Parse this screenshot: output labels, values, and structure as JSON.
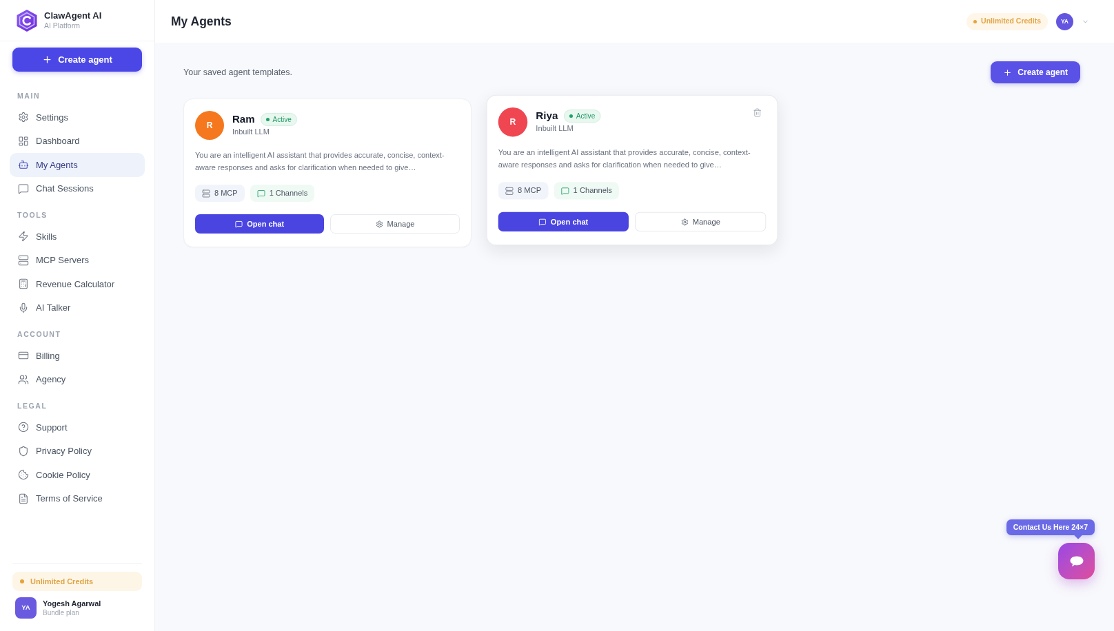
{
  "sidebar": {
    "brand": {
      "name": "ClawAgent AI",
      "tagline": "AI Platform"
    },
    "create_button": "Create agent",
    "sections": [
      {
        "title": "MAIN",
        "items": [
          {
            "label": "Settings",
            "selected": false
          },
          {
            "label": "Dashboard",
            "selected": false
          },
          {
            "label": "My Agents",
            "selected": true
          },
          {
            "label": "Chat Sessions",
            "selected": false
          }
        ]
      },
      {
        "title": "TOOLS",
        "items": [
          {
            "label": "Skills",
            "selected": false
          },
          {
            "label": "MCP Servers",
            "selected": false
          },
          {
            "label": "Revenue Calculator",
            "selected": false
          },
          {
            "label": "AI Talker",
            "selected": false
          }
        ]
      },
      {
        "title": "ACCOUNT",
        "items": [
          {
            "label": "Billing",
            "selected": false
          },
          {
            "label": "Agency",
            "selected": false
          }
        ]
      },
      {
        "title": "LEGAL",
        "items": [
          {
            "label": "Support",
            "selected": false
          },
          {
            "label": "Privacy Policy",
            "selected": false
          },
          {
            "label": "Cookie Policy",
            "selected": false
          },
          {
            "label": "Terms of Service",
            "selected": false
          }
        ]
      }
    ],
    "credits": "Unlimited Credits",
    "user": {
      "initials": "YA",
      "name": "Yogesh Agarwal",
      "plan": "Bundle plan"
    }
  },
  "header": {
    "title": "My Agents",
    "credits": "Unlimited Credits",
    "avatar": "YA"
  },
  "main": {
    "subtitle": "Your saved agent templates.",
    "create_button": "Create agent",
    "agents": [
      {
        "initial": "R",
        "name": "Ram",
        "color": "#f5781e",
        "status": "Active",
        "model": "Inbuilt LLM",
        "description": "You are an intelligent AI assistant that provides accurate, concise, context-aware responses and asks for clarification when needed to give…",
        "mcp": "8 MCP",
        "channels": "1 Channels",
        "hovered": false,
        "open_button": "Open chat",
        "manage_button": "Manage"
      },
      {
        "initial": "R",
        "name": "Riya",
        "color": "#ef4652",
        "status": "Active",
        "model": "Inbuilt LLM",
        "description": "You are an intelligent AI assistant that provides accurate, concise, context-aware responses and asks for clarification when needed to give…",
        "mcp": "8 MCP",
        "channels": "1 Channels",
        "hovered": true,
        "open_button": "Open chat",
        "manage_button": "Manage"
      }
    ]
  },
  "support_widget": {
    "tooltip": "Contact Us Here 24×7"
  }
}
